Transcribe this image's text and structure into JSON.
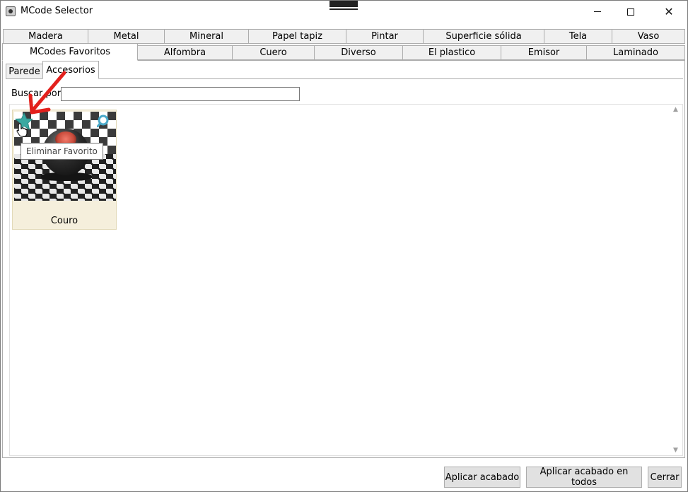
{
  "window": {
    "title": "MCode Selector"
  },
  "tabs_row1": [
    {
      "label": "Madera"
    },
    {
      "label": "Metal"
    },
    {
      "label": "Mineral"
    },
    {
      "label": "Papel tapiz"
    },
    {
      "label": "Pintar"
    },
    {
      "label": "Superficie sólida"
    },
    {
      "label": "Tela"
    },
    {
      "label": "Vaso"
    }
  ],
  "tabs_row2": [
    {
      "label": "MCodes Favoritos",
      "selected": true
    },
    {
      "label": "Alfombra"
    },
    {
      "label": "Cuero"
    },
    {
      "label": "Diverso"
    },
    {
      "label": "El plastico"
    },
    {
      "label": "Emisor"
    },
    {
      "label": "Laminado"
    }
  ],
  "subtabs": [
    {
      "label": "Parede"
    },
    {
      "label": "Accesorios",
      "selected": true
    }
  ],
  "search": {
    "label": "Buscar por:",
    "value": "",
    "placeholder": ""
  },
  "materials": [
    {
      "name": "Couro",
      "favorite": true,
      "tooltip": "Eliminar Favorito"
    }
  ],
  "buttons": {
    "apply": "Aplicar acabado",
    "apply_all": "Aplicar acabado en todos",
    "close": "Cerrar"
  },
  "colors": {
    "star": "#3aa9a1",
    "arrow": "#e3201c",
    "card_bg": "#f5efdc",
    "info": "#4aa9c9"
  },
  "icons": {
    "star": "star-icon",
    "info": "magnifier-icon",
    "cursor": "hand-cursor-icon",
    "annotation": "arrow-annotation-icon"
  }
}
